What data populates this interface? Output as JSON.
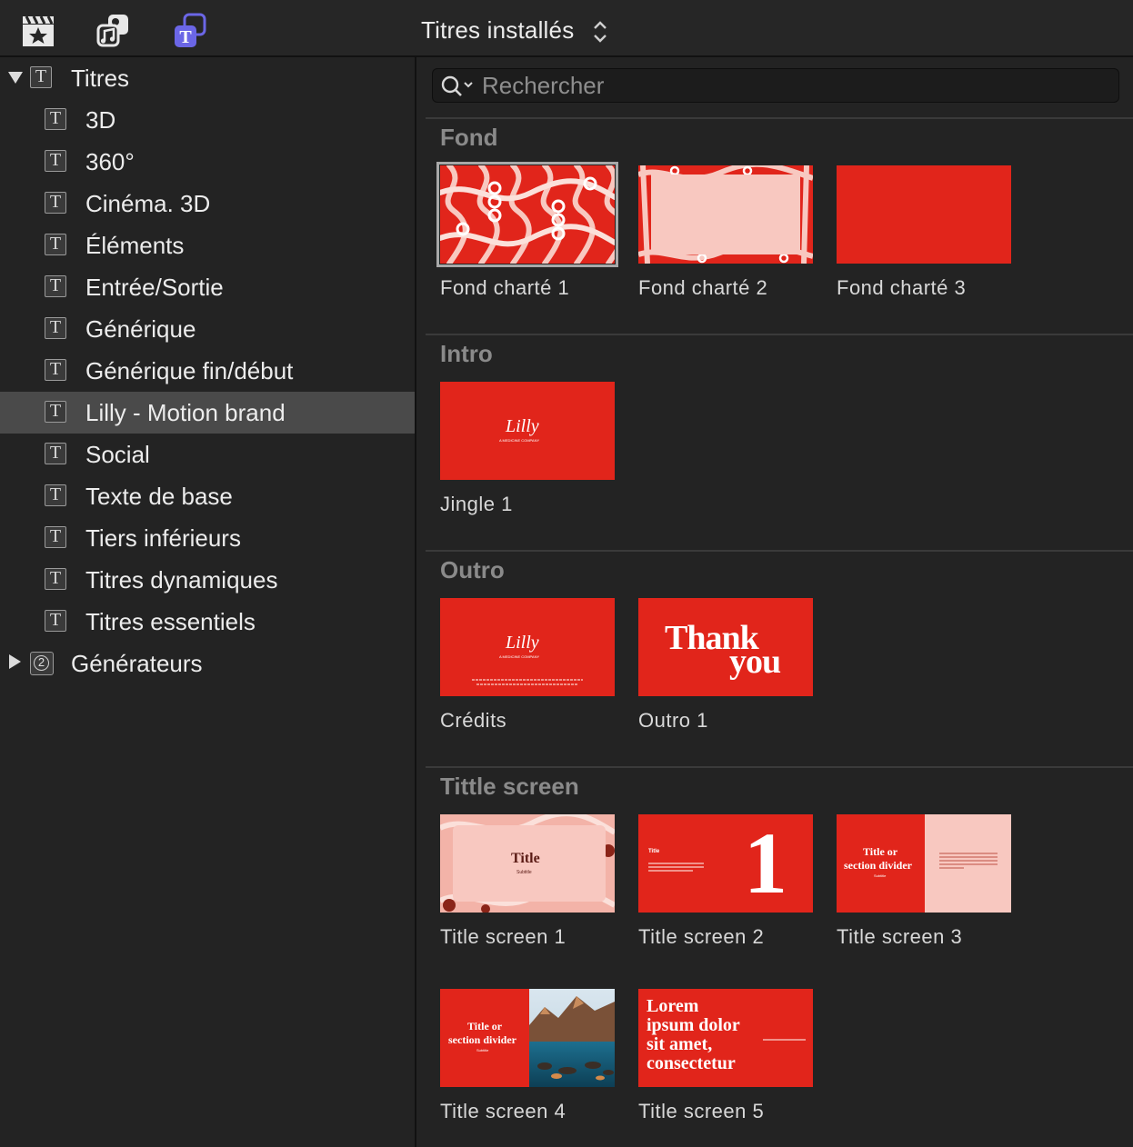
{
  "toolbar": {
    "title": "Titres installés",
    "icons": [
      "clapper-star-icon",
      "music-photo-icon",
      "titles-icon"
    ]
  },
  "sidebar": {
    "root_label": "Titres",
    "items": [
      {
        "label": "3D"
      },
      {
        "label": "360°"
      },
      {
        "label": "Cinéma. 3D"
      },
      {
        "label": "Éléments"
      },
      {
        "label": "Entrée/Sortie"
      },
      {
        "label": "Générique"
      },
      {
        "label": "Générique fin/début"
      },
      {
        "label": "Lilly - Motion brand",
        "selected": true
      },
      {
        "label": "Social"
      },
      {
        "label": "Texte de base"
      },
      {
        "label": "Tiers inférieurs"
      },
      {
        "label": "Titres dynamiques"
      },
      {
        "label": "Titres essentiels"
      }
    ],
    "generators_label": "Générateurs",
    "generators_badge": "2"
  },
  "search": {
    "placeholder": "Rechercher",
    "value": ""
  },
  "sections": [
    {
      "title": "Fond",
      "tiles": [
        "Fond charté 1",
        "Fond charté 2",
        "Fond charté 3"
      ]
    },
    {
      "title": "Intro",
      "tiles": [
        "Jingle 1"
      ]
    },
    {
      "title": "Outro",
      "tiles": [
        "Crédits",
        "Outro 1"
      ]
    },
    {
      "title": "Tittle screen",
      "tiles": [
        "Title screen 1",
        "Title screen 2",
        "Title screen 3",
        "Title screen 4",
        "Title screen 5"
      ]
    }
  ],
  "thumbnails": {
    "logo_text": "Lilly",
    "logo_tagline": "A MEDICINE COMPANY",
    "outro1_line1": "Thank",
    "outro1_line2": "you",
    "ts1_title": "Title",
    "ts1_subtitle": "Subtitle",
    "ts2_title": "Title",
    "ts2_number": "1",
    "ts3_title_line1": "Title or",
    "ts3_title_line2": "section divider",
    "ts3_subtitle": "Subtitle",
    "ts4_title_line1": "Title or",
    "ts4_title_line2": "section divider",
    "ts4_subtitle": "Subtitle",
    "ts5_line1": "Lorem",
    "ts5_line2": "ipsum dolor",
    "ts5_line3": "sit amet,",
    "ts5_line4": "consectetur"
  },
  "colors": {
    "brand_red": "#e1251b",
    "pink": "#f8c8c0",
    "selection": "#4a4a4a"
  }
}
